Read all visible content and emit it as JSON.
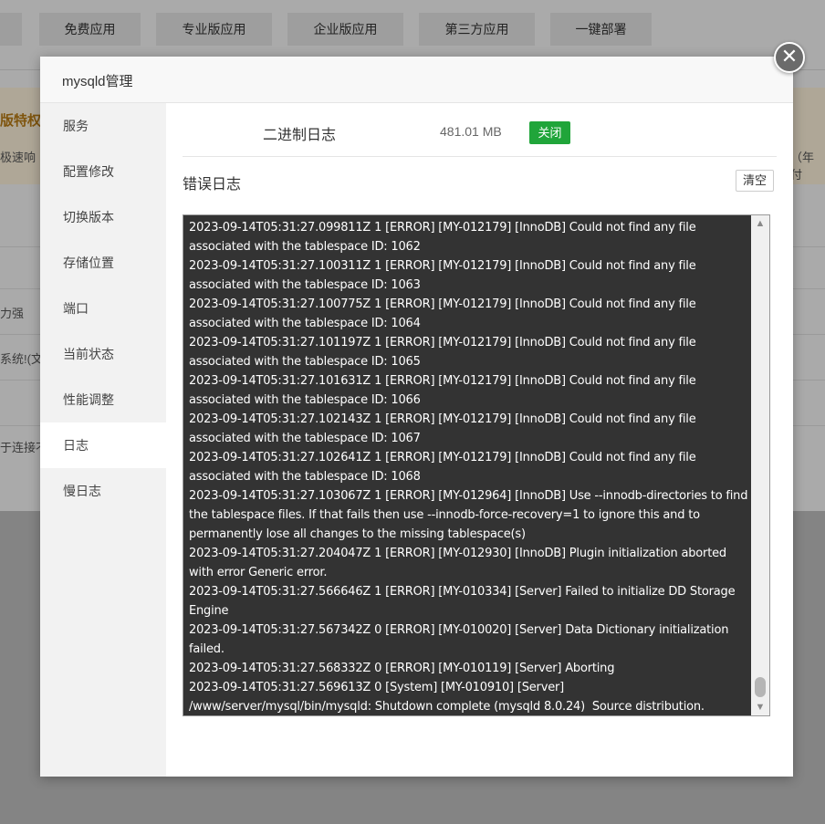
{
  "background": {
    "tabs": [
      "免费应用",
      "专业版应用",
      "企业版应用",
      "第三方应用",
      "一键部署"
    ],
    "banner_title": "版特权",
    "banner_text": "极速响",
    "banner_right": "（年付",
    "row_texts": [
      "力强",
      "系统!(文",
      "于连接不"
    ]
  },
  "modal": {
    "title": "mysqld管理",
    "close_symbol": "✕",
    "nav": [
      "服务",
      "配置修改",
      "切换版本",
      "存储位置",
      "端口",
      "当前状态",
      "性能调整",
      "日志",
      "慢日志"
    ],
    "active_nav": "日志",
    "binlog": {
      "label": "二进制日志",
      "size": "481.01 MB",
      "button": "关闭"
    },
    "errlog": {
      "title": "错误日志",
      "clear_button": "清空",
      "lines": [
        "2023-09-14T05:31:27.099811Z 1 [ERROR] [MY-012179] [InnoDB] Could not find any file associated with the tablespace ID: 1062",
        "2023-09-14T05:31:27.100311Z 1 [ERROR] [MY-012179] [InnoDB] Could not find any file associated with the tablespace ID: 1063",
        "2023-09-14T05:31:27.100775Z 1 [ERROR] [MY-012179] [InnoDB] Could not find any file associated with the tablespace ID: 1064",
        "2023-09-14T05:31:27.101197Z 1 [ERROR] [MY-012179] [InnoDB] Could not find any file associated with the tablespace ID: 1065",
        "2023-09-14T05:31:27.101631Z 1 [ERROR] [MY-012179] [InnoDB] Could not find any file associated with the tablespace ID: 1066",
        "2023-09-14T05:31:27.102143Z 1 [ERROR] [MY-012179] [InnoDB] Could not find any file associated with the tablespace ID: 1067",
        "2023-09-14T05:31:27.102641Z 1 [ERROR] [MY-012179] [InnoDB] Could not find any file associated with the tablespace ID: 1068",
        "2023-09-14T05:31:27.103067Z 1 [ERROR] [MY-012964] [InnoDB] Use --innodb-directories to find the tablespace files. If that fails then use --innodb-force-recovery=1 to ignore this and to permanently lose all changes to the missing tablespace(s)",
        "2023-09-14T05:31:27.204047Z 1 [ERROR] [MY-012930] [InnoDB] Plugin initialization aborted with error Generic error.",
        "2023-09-14T05:31:27.566646Z 1 [ERROR] [MY-010334] [Server] Failed to initialize DD Storage Engine",
        "2023-09-14T05:31:27.567342Z 0 [ERROR] [MY-010020] [Server] Data Dictionary initialization failed.",
        "2023-09-14T05:31:27.568332Z 0 [ERROR] [MY-010119] [Server] Aborting",
        "2023-09-14T05:31:27.569613Z 0 [System] [MY-010910] [Server] /www/server/mysql/bin/mysqld: Shutdown complete (mysqld 8.0.24)  Source distribution."
      ]
    }
  }
}
